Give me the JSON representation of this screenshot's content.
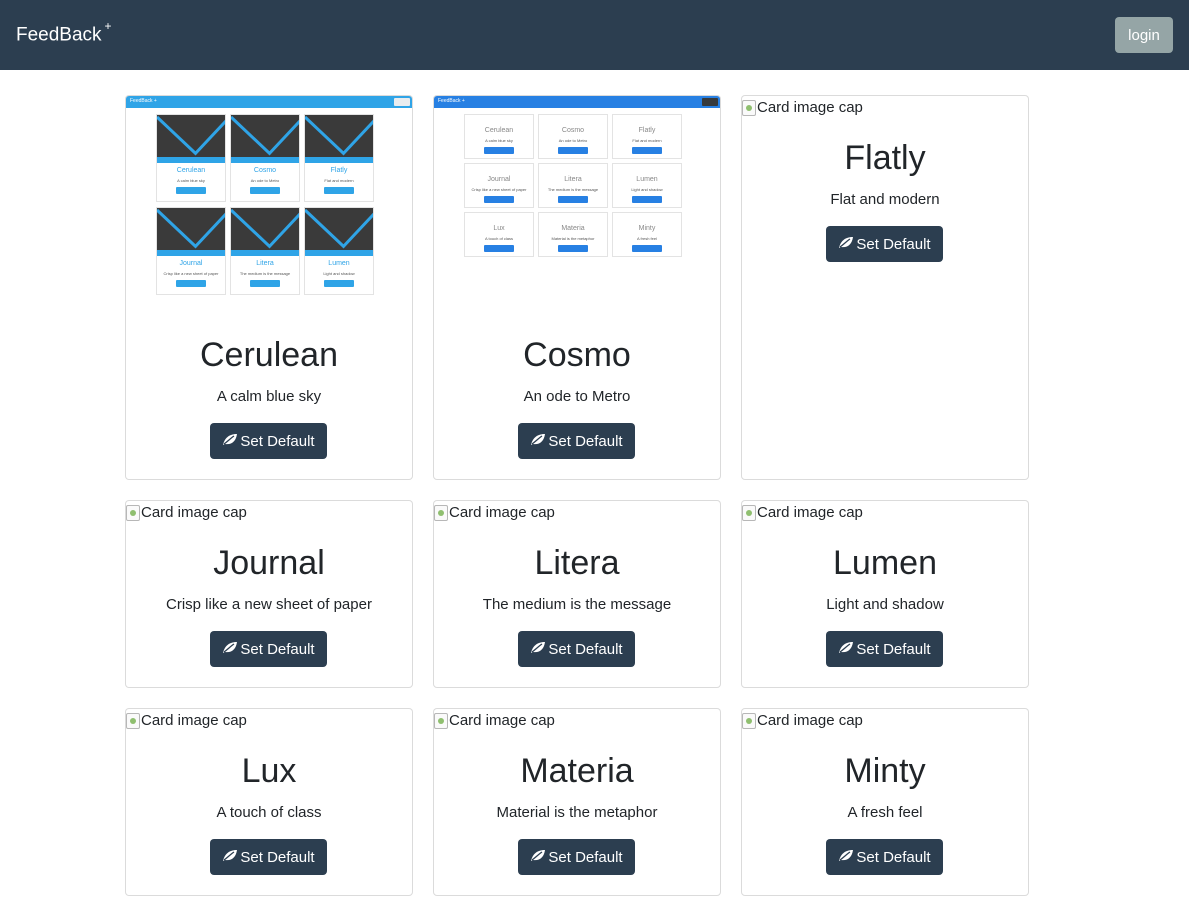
{
  "navbar": {
    "brand": "FeedBack",
    "brand_sup": "+",
    "login_label": "login"
  },
  "colors": {
    "navbar_bg": "#2c3e50",
    "login_bg": "#95a5a6",
    "button_bg": "#2c3e50"
  },
  "themes": [
    {
      "name": "Cerulean",
      "description": "A calm blue sky",
      "button_label": "Set Default",
      "image_alt": "Card image cap"
    },
    {
      "name": "Cosmo",
      "description": "An ode to Metro",
      "button_label": "Set Default",
      "image_alt": "Card image cap"
    },
    {
      "name": "Flatly",
      "description": "Flat and modern",
      "button_label": "Set Default",
      "image_alt": "Card image cap"
    },
    {
      "name": "Journal",
      "description": "Crisp like a new sheet of paper",
      "button_label": "Set Default",
      "image_alt": "Card image cap"
    },
    {
      "name": "Litera",
      "description": "The medium is the message",
      "button_label": "Set Default",
      "image_alt": "Card image cap"
    },
    {
      "name": "Lumen",
      "description": "Light and shadow",
      "button_label": "Set Default",
      "image_alt": "Card image cap"
    },
    {
      "name": "Lux",
      "description": "A touch of class",
      "button_label": "Set Default",
      "image_alt": "Card image cap"
    },
    {
      "name": "Materia",
      "description": "Material is the metaphor",
      "button_label": "Set Default",
      "image_alt": "Card image cap"
    },
    {
      "name": "Minty",
      "description": "A fresh feel",
      "button_label": "Set Default",
      "image_alt": "Card image cap"
    }
  ],
  "thumbnails": {
    "cerulean": {
      "brand": "FeedBack +",
      "login": "login",
      "cards": [
        {
          "title": "Cerulean",
          "text": "A calm blue sky",
          "btn": "Set Default"
        },
        {
          "title": "Cosmo",
          "text": "An ode to Metro",
          "btn": "Set Default"
        },
        {
          "title": "Flatly",
          "text": "Flat and modern",
          "btn": "Set Default"
        },
        {
          "title": "Journal",
          "text": "Crisp like a new sheet of paper",
          "btn": "Set Default"
        },
        {
          "title": "Litera",
          "text": "The medium is the message",
          "btn": "Set Default"
        },
        {
          "title": "Lumen",
          "text": "Light and shadow",
          "btn": "Set Default"
        }
      ]
    },
    "cosmo": {
      "brand": "FeedBack +",
      "login": "login",
      "cards": [
        {
          "title": "Cerulean",
          "text": "A calm blue sky",
          "btn": "Set Default"
        },
        {
          "title": "Cosmo",
          "text": "An ode to Metro",
          "btn": "Set Default"
        },
        {
          "title": "Flatly",
          "text": "Flat and modern",
          "btn": "Set Default"
        },
        {
          "title": "Journal",
          "text": "Crisp like a new sheet of paper",
          "btn": "Set Default"
        },
        {
          "title": "Litera",
          "text": "The medium is the message",
          "btn": "Set Default"
        },
        {
          "title": "Lumen",
          "text": "Light and shadow",
          "btn": "Set Default"
        },
        {
          "title": "Lux",
          "text": "A touch of class",
          "btn": "Set Default"
        },
        {
          "title": "Materia",
          "text": "Material is the metaphor",
          "btn": "Set Default"
        },
        {
          "title": "Minty",
          "text": "A fresh feel",
          "btn": "Set Default"
        }
      ]
    }
  }
}
